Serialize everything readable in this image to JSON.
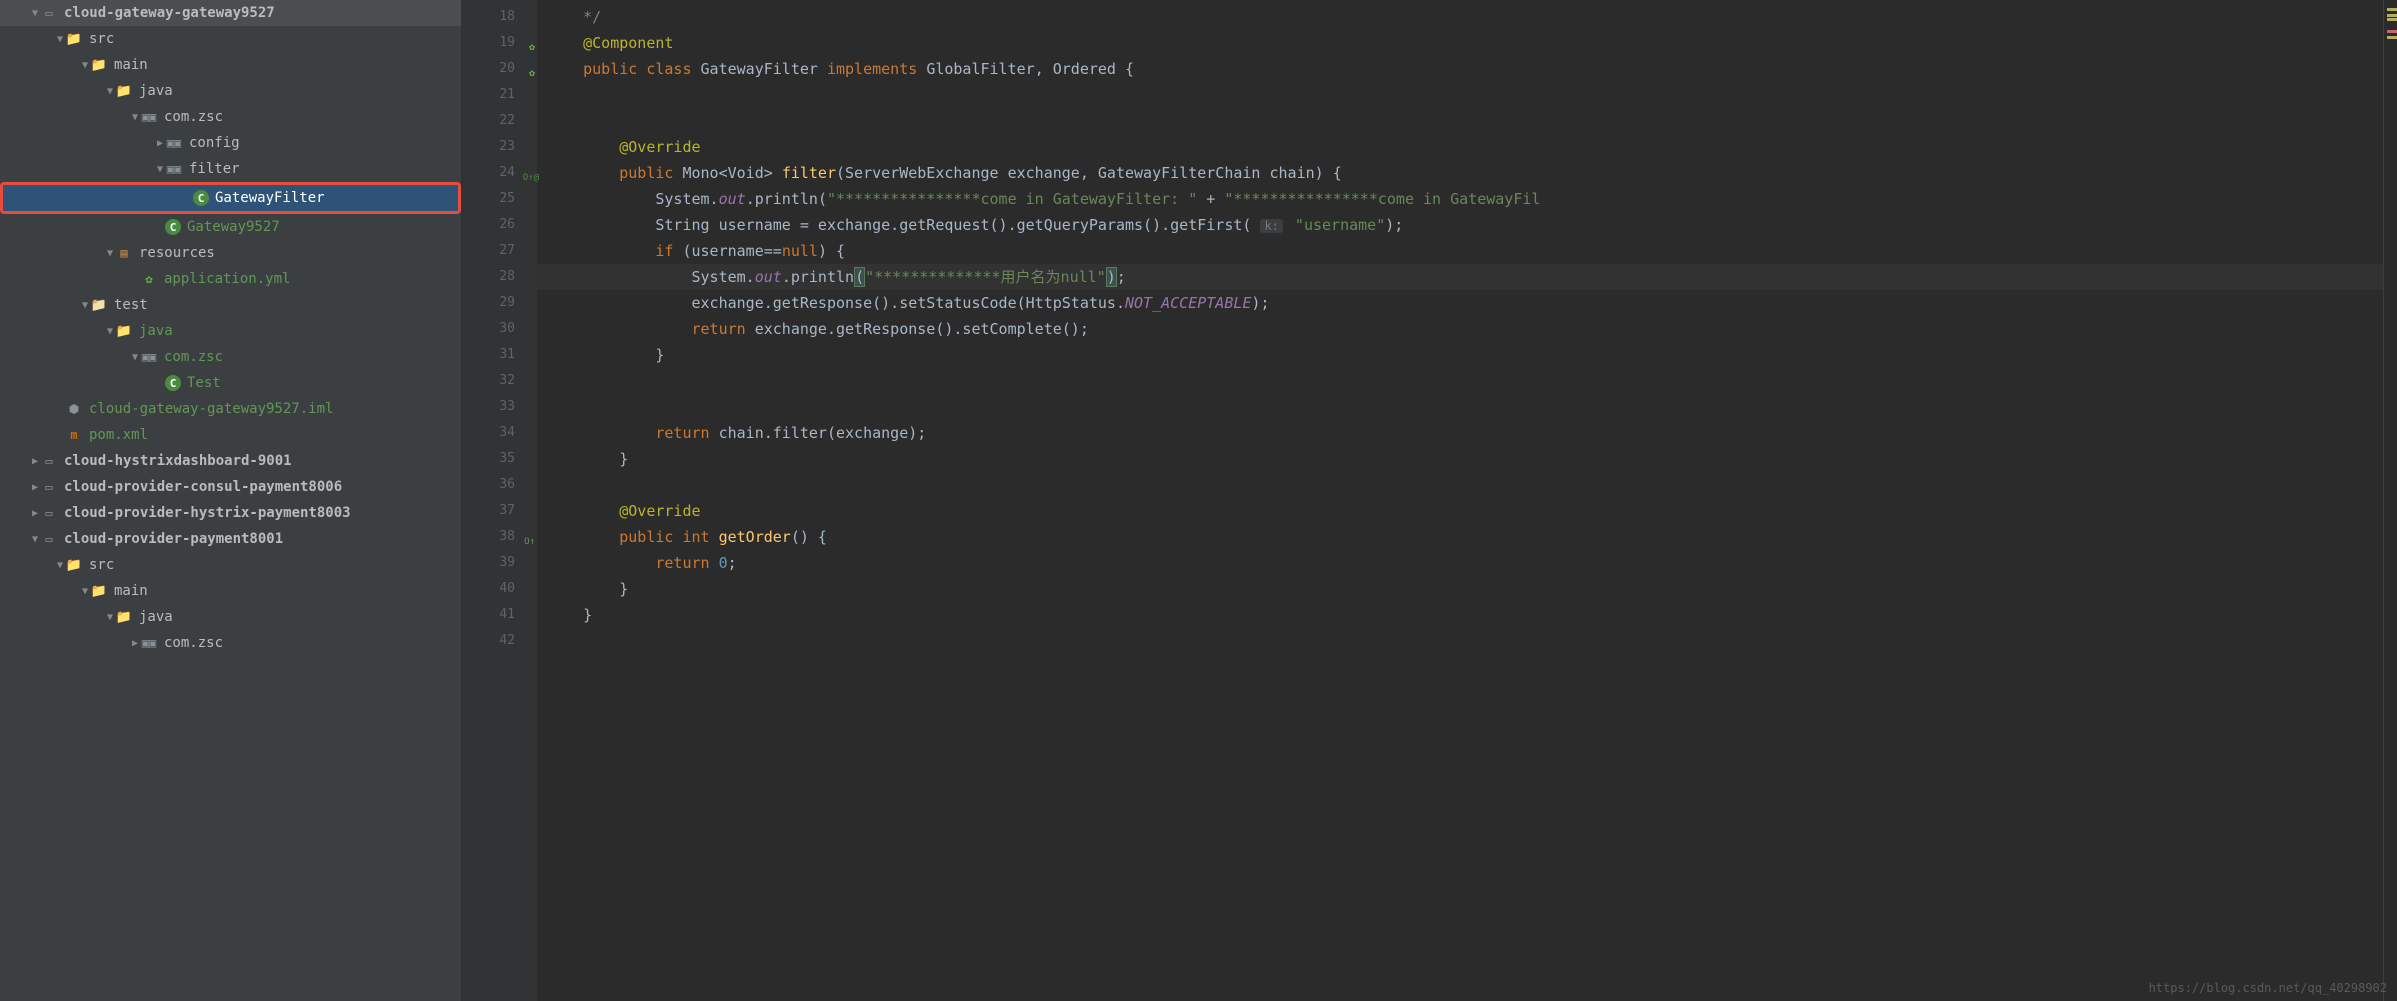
{
  "sidebar": {
    "items": [
      {
        "indent": 30,
        "arrow": "down",
        "icon": "module",
        "label": "cloud-gateway-gateway9527",
        "bold": true
      },
      {
        "indent": 55,
        "arrow": "down",
        "icon": "folder-blue",
        "label": "src"
      },
      {
        "indent": 80,
        "arrow": "down",
        "icon": "folder-blue",
        "label": "main"
      },
      {
        "indent": 105,
        "arrow": "down",
        "icon": "folder-blue",
        "label": "java"
      },
      {
        "indent": 130,
        "arrow": "down",
        "icon": "package",
        "label": "com.zsc"
      },
      {
        "indent": 155,
        "arrow": "right",
        "icon": "package",
        "label": "config"
      },
      {
        "indent": 155,
        "arrow": "down",
        "icon": "package",
        "label": "filter"
      },
      {
        "indent": 180,
        "arrow": "",
        "icon": "class-icon",
        "label": "GatewayFilter",
        "selected": true,
        "redbox": true
      },
      {
        "indent": 155,
        "arrow": "",
        "icon": "class-icon",
        "label": "Gateway9527",
        "green": true
      },
      {
        "indent": 105,
        "arrow": "down",
        "icon": "res",
        "label": "resources"
      },
      {
        "indent": 130,
        "arrow": "",
        "icon": "spring",
        "label": "application.yml",
        "green": true
      },
      {
        "indent": 80,
        "arrow": "down",
        "icon": "folder",
        "label": "test"
      },
      {
        "indent": 105,
        "arrow": "down",
        "icon": "folder-blue",
        "label": "java",
        "green": true
      },
      {
        "indent": 130,
        "arrow": "down",
        "icon": "package",
        "label": "com.zsc",
        "green": true
      },
      {
        "indent": 155,
        "arrow": "",
        "icon": "class-icon",
        "label": "Test",
        "green": true
      },
      {
        "indent": 55,
        "arrow": "",
        "icon": "iml",
        "label": "cloud-gateway-gateway9527.iml",
        "green": true
      },
      {
        "indent": 55,
        "arrow": "",
        "icon": "maven",
        "label": "pom.xml",
        "green": true
      },
      {
        "indent": 30,
        "arrow": "right",
        "icon": "module",
        "label": "cloud-hystrixdashboard-9001",
        "bold": true
      },
      {
        "indent": 30,
        "arrow": "right",
        "icon": "module",
        "label": "cloud-provider-consul-payment8006",
        "bold": true
      },
      {
        "indent": 30,
        "arrow": "right",
        "icon": "module",
        "label": "cloud-provider-hystrix-payment8003",
        "bold": true
      },
      {
        "indent": 30,
        "arrow": "down",
        "icon": "module",
        "label": "cloud-provider-payment8001",
        "bold": true
      },
      {
        "indent": 55,
        "arrow": "down",
        "icon": "folder-blue",
        "label": "src"
      },
      {
        "indent": 80,
        "arrow": "down",
        "icon": "folder-blue",
        "label": "main"
      },
      {
        "indent": 105,
        "arrow": "down",
        "icon": "folder-blue",
        "label": "java"
      },
      {
        "indent": 130,
        "arrow": "right",
        "icon": "package",
        "label": "com.zsc"
      }
    ]
  },
  "gutter": {
    "start": 18,
    "end": 42,
    "icons": {
      "19": "spring",
      "20": "spring",
      "24": "override",
      "38": "up"
    }
  },
  "code": {
    "currentLine": 28,
    "lines": [
      {
        "n": 18,
        "html": "    <span class='comment'>*/</span>"
      },
      {
        "n": 19,
        "html": "    <span class='ann'>@Component</span>"
      },
      {
        "n": 20,
        "html": "    <span class='kw'>public class </span><span class='type'>GatewayFilter </span><span class='kw'>implements </span><span class='type'>GlobalFilter</span><span class='paren'>, </span><span class='type'>Ordered </span><span class='paren'>{</span>"
      },
      {
        "n": 21,
        "html": ""
      },
      {
        "n": 22,
        "html": ""
      },
      {
        "n": 23,
        "html": "        <span class='ann'>@Override</span>"
      },
      {
        "n": 24,
        "html": "        <span class='kw'>public </span><span class='type'>Mono&lt;Void&gt; </span><span class='method'>filter</span><span class='paren'>(ServerWebExchange exchange, GatewayFilterChain chain) {</span>"
      },
      {
        "n": 25,
        "html": "            <span class='type'>System.</span><span class='field'>out</span><span class='type'>.println</span><span class='paren'>(</span><span class='str'>\"****************come in GatewayFilter: \"</span><span class='paren'> + </span><span class='str'>\"****************come in GatewayFil</span>"
      },
      {
        "n": 26,
        "html": "            <span class='type'>String username = exchange.getRequest().getQueryParams().getFirst(</span> <span class='param-hint'>k:</span> <span class='str'>\"username\"</span><span class='paren'>);</span>"
      },
      {
        "n": 27,
        "html": "            <span class='kw'>if </span><span class='paren'>(username==</span><span class='kw'>null</span><span class='paren'>) {</span>"
      },
      {
        "n": 28,
        "html": "                <span class='type'>System.</span><span class='field'>out</span><span class='type'>.println</span><span class='brace-hl paren'>(</span><span class='str'>\"**************用户名为null\"</span><span class='brace-hl paren'>)</span><span class='paren'>;</span>"
      },
      {
        "n": 29,
        "html": "                <span class='type'>exchange.getResponse().setStatusCode(HttpStatus.</span><span class='const'>NOT_ACCEPTABLE</span><span class='paren'>);</span>"
      },
      {
        "n": 30,
        "html": "                <span class='kw'>return </span><span class='type'>exchange.getResponse().setComplete();</span>"
      },
      {
        "n": 31,
        "html": "            <span class='paren'>}</span>"
      },
      {
        "n": 32,
        "html": ""
      },
      {
        "n": 33,
        "html": ""
      },
      {
        "n": 34,
        "html": "            <span class='kw'>return </span><span class='type'>chain.filter(exchange);</span>"
      },
      {
        "n": 35,
        "html": "        <span class='paren'>}</span>"
      },
      {
        "n": 36,
        "html": ""
      },
      {
        "n": 37,
        "html": "        <span class='ann'>@Override</span>"
      },
      {
        "n": 38,
        "html": "        <span class='kw'>public int </span><span class='method'>getOrder</span><span class='paren'>() {</span>"
      },
      {
        "n": 39,
        "html": "            <span class='kw'>return </span><span class='num'>0</span><span class='paren'>;</span>"
      },
      {
        "n": 40,
        "html": "        <span class='paren'>}</span>"
      },
      {
        "n": 41,
        "html": "    <span class='paren'>}</span>"
      },
      {
        "n": 42,
        "html": ""
      }
    ]
  },
  "watermark": "https://blog.csdn.net/qq_40298902"
}
